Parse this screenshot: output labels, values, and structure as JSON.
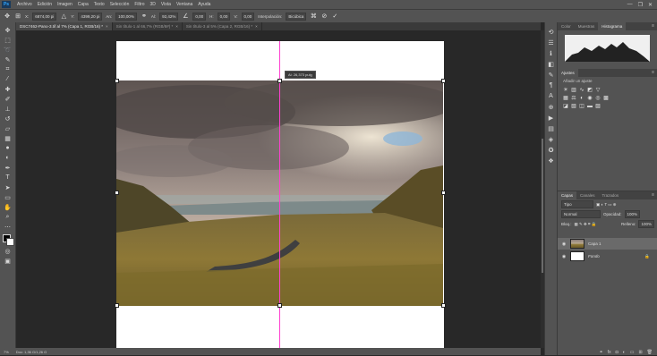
{
  "app": {
    "logo": "Ps"
  },
  "menu": [
    "Archivo",
    "Edición",
    "Imagen",
    "Capa",
    "Texto",
    "Selección",
    "Filtro",
    "3D",
    "Vista",
    "Ventana",
    "Ayuda"
  ],
  "window_controls": [
    "—",
    "❐",
    "✕"
  ],
  "options": {
    "x_label": "X:",
    "x_value": "6874,00 pi",
    "y_label": "Y:",
    "y_value": "4399,20 pi",
    "w_label": "An:",
    "w_value": "100,00%",
    "h_label": "Al:",
    "h_value": "92,42%",
    "angle_value": "0,00",
    "hskew_label": "H:",
    "hskew_value": "0,00",
    "vskew_label": "V:",
    "vskew_value": "0,00",
    "interp_label": "Interpolación:",
    "interp_value": "Bicúbica",
    "cancel_icon": "⊘",
    "commit_icon": "✓"
  },
  "tabs": [
    {
      "label": "DSC7462-Pano-3.tif al 7% (Capa 1, RGB/16) *",
      "active": true
    },
    {
      "label": "Sin título-1 al 66,7% (RGB/8#) *",
      "active": false
    },
    {
      "label": "Sin título-3 al 5% (Capa 2, RGB/16) *",
      "active": false
    }
  ],
  "tab_close": "×",
  "tools": [
    "move-icon",
    "marquee-icon",
    "lasso-icon",
    "quick-select-icon",
    "crop-icon",
    "eyedropper-icon",
    "healing-icon",
    "brush-icon",
    "stamp-icon",
    "history-brush-icon",
    "eraser-icon",
    "gradient-icon",
    "blur-icon",
    "dodge-icon",
    "pen-icon",
    "type-icon",
    "path-select-icon",
    "shape-icon",
    "hand-icon",
    "zoom-icon",
    "more-icon"
  ],
  "transform_tooltip": "Al: 26,373 pulg",
  "status": {
    "zoom": "7%",
    "doc": "Doc: 1,36 G/1,26 G"
  },
  "panels": {
    "top_tabs": [
      "Color",
      "Muestras",
      "Histograma"
    ],
    "top_active": "Histograma",
    "adjust_tab": "Ajustes",
    "adjust_hint": "Añadir un ajuste",
    "layers_tabs": [
      "Capas",
      "Canales",
      "Trazados"
    ],
    "layers_active": "Capas",
    "filter_value": "Tipo",
    "blend_mode": "Normal",
    "opacity_label": "Opacidad:",
    "opacity_value": "100%",
    "lock_label": "Bloq.:",
    "fill_label": "Relleno:",
    "fill_value": "100%",
    "layers": [
      {
        "name": "Capa 1",
        "selected": true
      },
      {
        "name": "Fondo",
        "selected": false
      }
    ]
  },
  "colors": {
    "guide": "#ff3fd0",
    "accent": "#31a8ff"
  }
}
